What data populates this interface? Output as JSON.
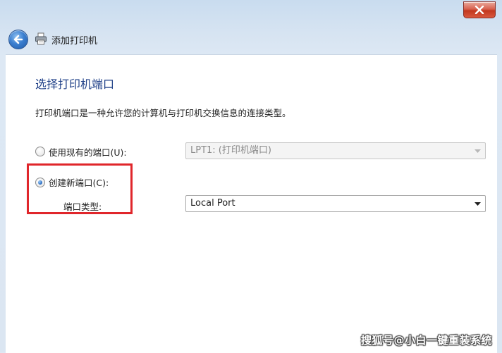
{
  "window": {
    "nav_title": "添加打印机"
  },
  "page": {
    "heading": "选择打印机端口",
    "description": "打印机端口是一种允许您的计算机与打印机交换信息的连接类型。"
  },
  "options": {
    "existing_port": {
      "label": "使用现有的端口(U):",
      "checked": false,
      "select_value": "LPT1: (打印机端口)",
      "select_enabled": false
    },
    "new_port": {
      "label": "创建新端口(C):",
      "checked": true,
      "type_label": "端口类型:",
      "select_value": "Local Port",
      "select_enabled": true
    }
  },
  "icons": {
    "back": "back-arrow-icon",
    "printer": "printer-icon",
    "close": "close-icon",
    "dropdown": "chevron-down-icon"
  },
  "colors": {
    "heading": "#1e3f87",
    "highlight_box": "#e0262b",
    "close_button": "#c2381f"
  },
  "watermark": "搜狐号@小白一键重装系统"
}
